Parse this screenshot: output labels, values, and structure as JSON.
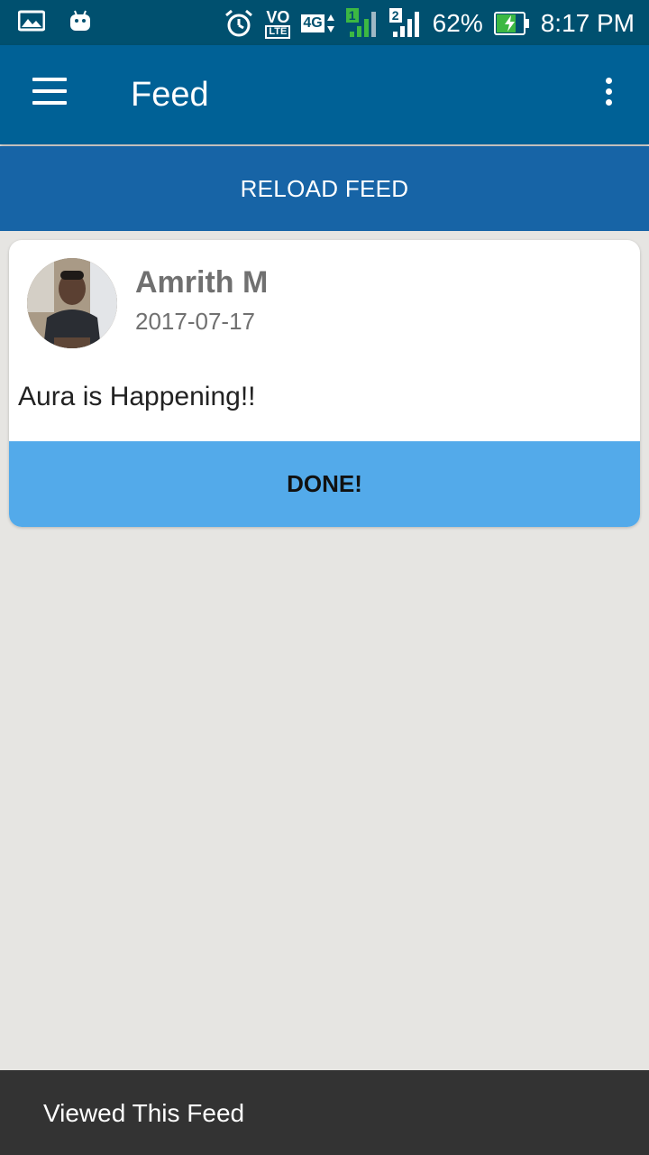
{
  "status_bar": {
    "battery": "62%",
    "time": "8:17 PM",
    "network_badge": "4G",
    "volte_top": "VO",
    "volte_bottom": "LTE",
    "sim1": "1",
    "sim2": "2"
  },
  "app_bar": {
    "title": "Feed"
  },
  "reload": {
    "label": "RELOAD FEED"
  },
  "feed": [
    {
      "author": "Amrith M",
      "date": "2017-07-17",
      "text": "Aura is Happening!!",
      "action": "DONE!"
    }
  ],
  "snackbar": {
    "message": "Viewed This Feed"
  },
  "colors": {
    "status_bar": "#00506f",
    "app_bar": "#006196",
    "reload_bar": "#1764a6",
    "done_button": "#53aaea",
    "background": "#e6e5e2",
    "snackbar": "#333333"
  }
}
